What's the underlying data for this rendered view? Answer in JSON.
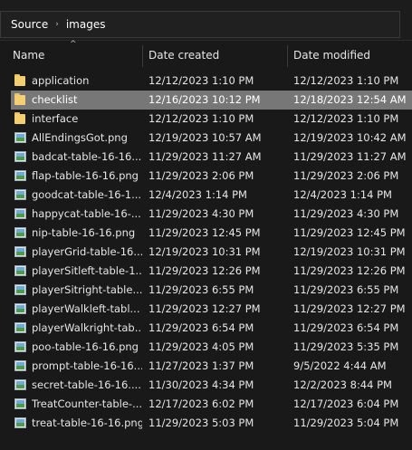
{
  "breadcrumb": {
    "items": [
      "Source",
      "images"
    ],
    "separator": "›"
  },
  "columns": {
    "name": "Name",
    "date_created": "Date created",
    "date_modified": "Date modified",
    "sort_indicator": "^"
  },
  "files": [
    {
      "name": "application",
      "type": "folder",
      "created": "12/12/2023 1:10 PM",
      "modified": "12/12/2023 1:10 PM"
    },
    {
      "name": "checklist",
      "type": "folder",
      "created": "12/16/2023 10:12 PM",
      "modified": "12/18/2023 12:54 AM",
      "selected": true
    },
    {
      "name": "interface",
      "type": "folder",
      "created": "12/12/2023 1:10 PM",
      "modified": "12/12/2023 1:10 PM"
    },
    {
      "name": "AllEndingsGot.png",
      "type": "image",
      "created": "12/19/2023 10:57 AM",
      "modified": "12/19/2023 10:42 AM"
    },
    {
      "name": "badcat-table-16-16....",
      "type": "image",
      "created": "11/29/2023 11:27 AM",
      "modified": "11/29/2023 11:27 AM"
    },
    {
      "name": "flap-table-16-16.png",
      "type": "image",
      "created": "11/29/2023 2:06 PM",
      "modified": "11/29/2023 2:06 PM"
    },
    {
      "name": "goodcat-table-16-1...",
      "type": "image",
      "created": "12/4/2023 1:14 PM",
      "modified": "12/4/2023 1:14 PM"
    },
    {
      "name": "happycat-table-16-...",
      "type": "image",
      "created": "11/29/2023 4:30 PM",
      "modified": "11/29/2023 4:30 PM"
    },
    {
      "name": "nip-table-16-16.png",
      "type": "image",
      "created": "11/29/2023 12:45 PM",
      "modified": "11/29/2023 12:45 PM"
    },
    {
      "name": "playerGrid-table-16...",
      "type": "image",
      "created": "12/19/2023 10:31 PM",
      "modified": "12/19/2023 10:31 PM"
    },
    {
      "name": "playerSitleft-table-1...",
      "type": "image",
      "created": "11/29/2023 12:26 PM",
      "modified": "11/29/2023 12:26 PM"
    },
    {
      "name": "playerSitright-table...",
      "type": "image",
      "created": "11/29/2023 6:55 PM",
      "modified": "11/29/2023 6:55 PM"
    },
    {
      "name": "playerWalkleft-tabl...",
      "type": "image",
      "created": "11/29/2023 12:27 PM",
      "modified": "11/29/2023 12:27 PM"
    },
    {
      "name": "playerWalkright-tab...",
      "type": "image",
      "created": "11/29/2023 6:54 PM",
      "modified": "11/29/2023 6:54 PM"
    },
    {
      "name": "poo-table-16-16.png",
      "type": "image",
      "created": "11/29/2023 4:05 PM",
      "modified": "11/29/2023 5:35 PM"
    },
    {
      "name": "prompt-table-16-16....",
      "type": "image",
      "created": "11/27/2023 1:37 PM",
      "modified": "9/5/2022 4:44 AM"
    },
    {
      "name": "secret-table-16-16....",
      "type": "image",
      "created": "11/30/2023 4:34 PM",
      "modified": "12/2/2023 8:44 PM"
    },
    {
      "name": "TreatCounter-table-...",
      "type": "image",
      "created": "12/17/2023 6:02 PM",
      "modified": "12/17/2023 6:04 PM"
    },
    {
      "name": "treat-table-16-16.png",
      "type": "image",
      "created": "11/29/2023 5:03 PM",
      "modified": "11/29/2023 5:04 PM"
    }
  ]
}
